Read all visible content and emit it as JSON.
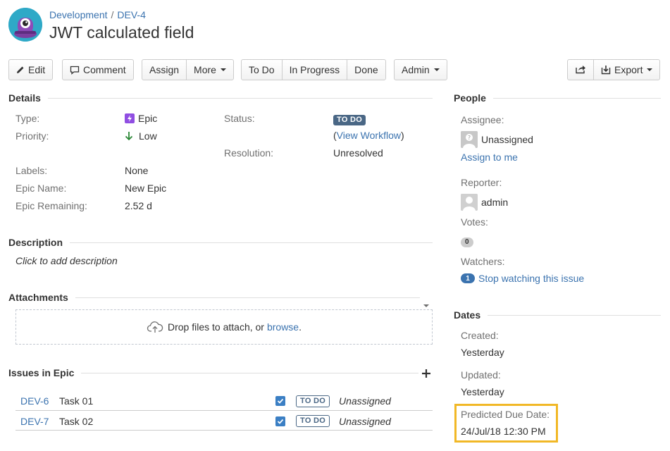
{
  "breadcrumbs": {
    "project": "Development",
    "separator": "/",
    "issue_key": "DEV-4"
  },
  "title": "JWT calculated field",
  "toolbar": {
    "edit": "Edit",
    "comment": "Comment",
    "assign": "Assign",
    "more": "More",
    "todo": "To Do",
    "in_progress": "In Progress",
    "done": "Done",
    "admin": "Admin",
    "export": "Export"
  },
  "details": {
    "heading": "Details",
    "type_label": "Type:",
    "type_value": "Epic",
    "priority_label": "Priority:",
    "priority_value": "Low",
    "status_label": "Status:",
    "status_value": "TO DO",
    "workflow_open": "(",
    "workflow_link": "View Workflow",
    "workflow_close": ")",
    "resolution_label": "Resolution:",
    "resolution_value": "Unresolved",
    "labels_label": "Labels:",
    "labels_value": "None",
    "epic_name_label": "Epic Name:",
    "epic_name_value": "New Epic",
    "epic_remaining_label": "Epic Remaining:",
    "epic_remaining_value": "2.52 d"
  },
  "description": {
    "heading": "Description",
    "placeholder": "Click to add description"
  },
  "attachments": {
    "heading": "Attachments",
    "drop_text": "Drop files to attach, or ",
    "browse": "browse",
    "period": "."
  },
  "issues_in_epic": {
    "heading": "Issues in Epic",
    "rows": [
      {
        "key": "DEV-6",
        "summary": "Task 01",
        "status": "TO DO",
        "assignee": "Unassigned"
      },
      {
        "key": "DEV-7",
        "summary": "Task 02",
        "status": "TO DO",
        "assignee": "Unassigned"
      }
    ]
  },
  "people": {
    "heading": "People",
    "assignee_label": "Assignee:",
    "assignee_value": "Unassigned",
    "assign_to_me": "Assign to me",
    "reporter_label": "Reporter:",
    "reporter_value": "admin",
    "votes_label": "Votes:",
    "votes_count": "0",
    "watchers_label": "Watchers:",
    "watchers_count": "1",
    "stop_watching": "Stop watching this issue"
  },
  "dates": {
    "heading": "Dates",
    "created_label": "Created:",
    "created_value": "Yesterday",
    "updated_label": "Updated:",
    "updated_value": "Yesterday",
    "predicted_label": "Predicted Due Date:",
    "predicted_value": "24/Jul/18 12:30 PM"
  },
  "colors": {
    "link": "#3b73af",
    "status_lozenge": "#4a6785",
    "epic_icon": "#904ee2",
    "priority_low": "#2a8735",
    "highlight": "#f1b826"
  }
}
